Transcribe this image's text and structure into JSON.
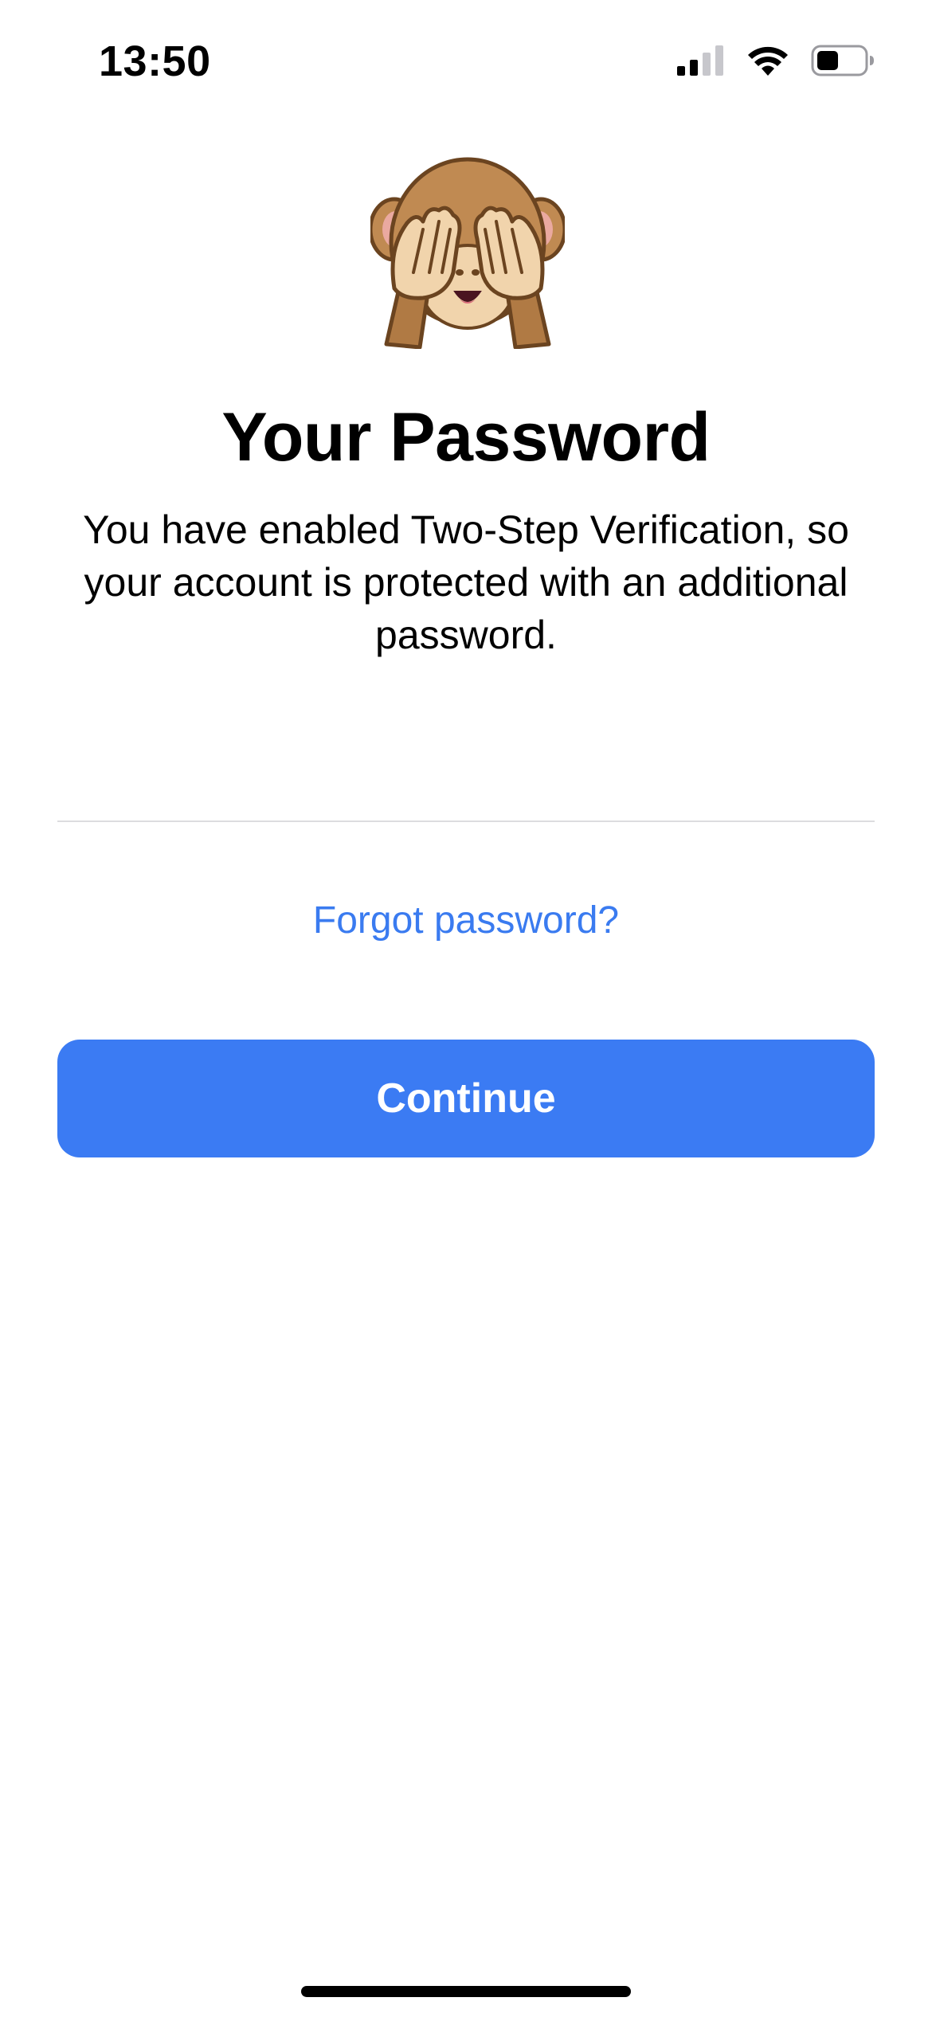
{
  "status_bar": {
    "time": "13:50",
    "icons": [
      "cellular-signal-icon",
      "wifi-icon",
      "battery-icon"
    ]
  },
  "hero": {
    "icon": "see-no-evil-monkey-icon"
  },
  "title": "Your Password",
  "description": "You have enabled Two-Step Verification, so your account is protected with an additional password.",
  "password_field": {
    "value": "",
    "placeholder": ""
  },
  "forgot_link": "Forgot password?",
  "continue_button": "Continue",
  "colors": {
    "accent": "#3b7bf3",
    "link": "#3a7bf0",
    "divider": "#dcdcdf",
    "background": "#ffffff"
  }
}
